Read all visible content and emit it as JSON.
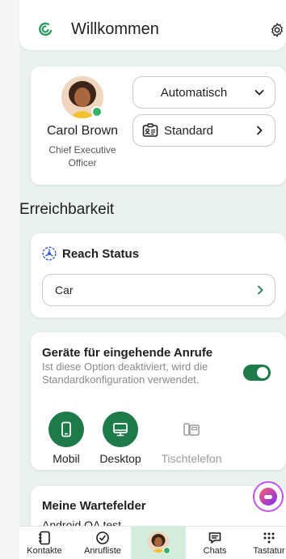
{
  "header": {
    "title": "Willkommen"
  },
  "profile": {
    "name": "Carol Brown",
    "role": "Chief Executive Officer",
    "mode": "Automatisch",
    "status": "Standard"
  },
  "availability": {
    "section_title": "Erreichbarkeit",
    "reach_title": "Reach Status",
    "reach_value": "Car"
  },
  "devices": {
    "title": "Geräte für eingehende Anrufe",
    "description": "Ist diese Option deaktiviert, wird die Standardkonfiguration verwendet.",
    "toggle_on": true,
    "items": [
      {
        "label": "Mobil",
        "active": true
      },
      {
        "label": "Desktop",
        "active": true
      },
      {
        "label": "Tischtelefon",
        "active": false
      }
    ]
  },
  "queues": {
    "title": "Meine Wartefelder",
    "first_item": "Android QA test"
  },
  "nav": {
    "kontakte": "Kontakte",
    "anrufliste": "Anrufliste",
    "chats": "Chats",
    "tastatur": "Tastatur"
  },
  "colors": {
    "accent": "#1f7a4a",
    "background": "#e9f2ec",
    "presence": "#34b36a"
  }
}
